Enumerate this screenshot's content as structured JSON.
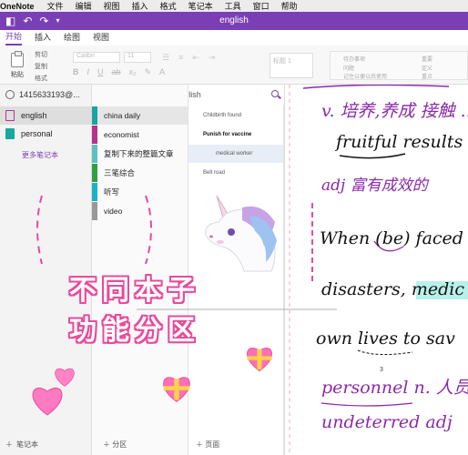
{
  "menubar": {
    "app_name": "OneNote",
    "items": [
      "文件",
      "编辑",
      "视图",
      "插入",
      "格式",
      "笔记本",
      "工具",
      "窗口",
      "帮助"
    ]
  },
  "window": {
    "title": "english"
  },
  "ribbon": {
    "tabs": [
      {
        "label": "开始",
        "active": true
      },
      {
        "label": "插入",
        "active": false
      },
      {
        "label": "绘图",
        "active": false
      },
      {
        "label": "视图",
        "active": false
      }
    ],
    "paste_label": "粘贴",
    "clipboard": [
      "剪切",
      "复制",
      "格式"
    ],
    "font_name": "Calibri",
    "font_size": "11",
    "styles_label": "标题 1",
    "tags": [
      "待办事项",
      "重要",
      "问题",
      "记住以便以后使用",
      "定义",
      "重点"
    ]
  },
  "notebooks": {
    "account": "1415633193@...",
    "items": [
      {
        "label": "english",
        "selected": true
      },
      {
        "label": "personal",
        "selected": false
      }
    ],
    "more_label": "更多笔记本",
    "add_label": "笔记本"
  },
  "sections": {
    "header_title": "english",
    "items": [
      {
        "label": "china daily",
        "color": "#1aa3a0",
        "selected": true
      },
      {
        "label": "economist",
        "color": "#b5338e",
        "selected": false
      },
      {
        "label": "复制下来的整篇文章",
        "color": "#5bc2c0",
        "selected": false
      },
      {
        "label": "三笔综合",
        "color": "#2ea043",
        "selected": false
      },
      {
        "label": "听写",
        "color": "#1bb3c4",
        "selected": false
      },
      {
        "label": "video",
        "color": "#999999",
        "selected": false
      }
    ],
    "add_label": "分区"
  },
  "pages": {
    "items": [
      {
        "label": "Childbirth found"
      },
      {
        "label": "Punish for vaccine"
      },
      {
        "label": "medical worker",
        "selected": true
      },
      {
        "label": "Belt road"
      }
    ],
    "add_label": "页面"
  },
  "overlay": {
    "line1": "不同本子",
    "line2": "功能分区"
  },
  "canvas": {
    "lines": [
      {
        "text": "v. 培养,养成 接触 ...",
        "color": "purple"
      },
      {
        "text": "fruitful results",
        "color": "black"
      },
      {
        "text": "adj 富有成效的",
        "color": "purple"
      },
      {
        "text": "When (be) faced wit",
        "color": "black"
      },
      {
        "text": "disasters, medic",
        "color": "black"
      },
      {
        "text": "own lives to sav",
        "color": "black"
      },
      {
        "text": "personnel n. 人员",
        "color": "purple"
      },
      {
        "text": "undeterred adj",
        "color": "purple"
      }
    ],
    "page_number": "3"
  }
}
